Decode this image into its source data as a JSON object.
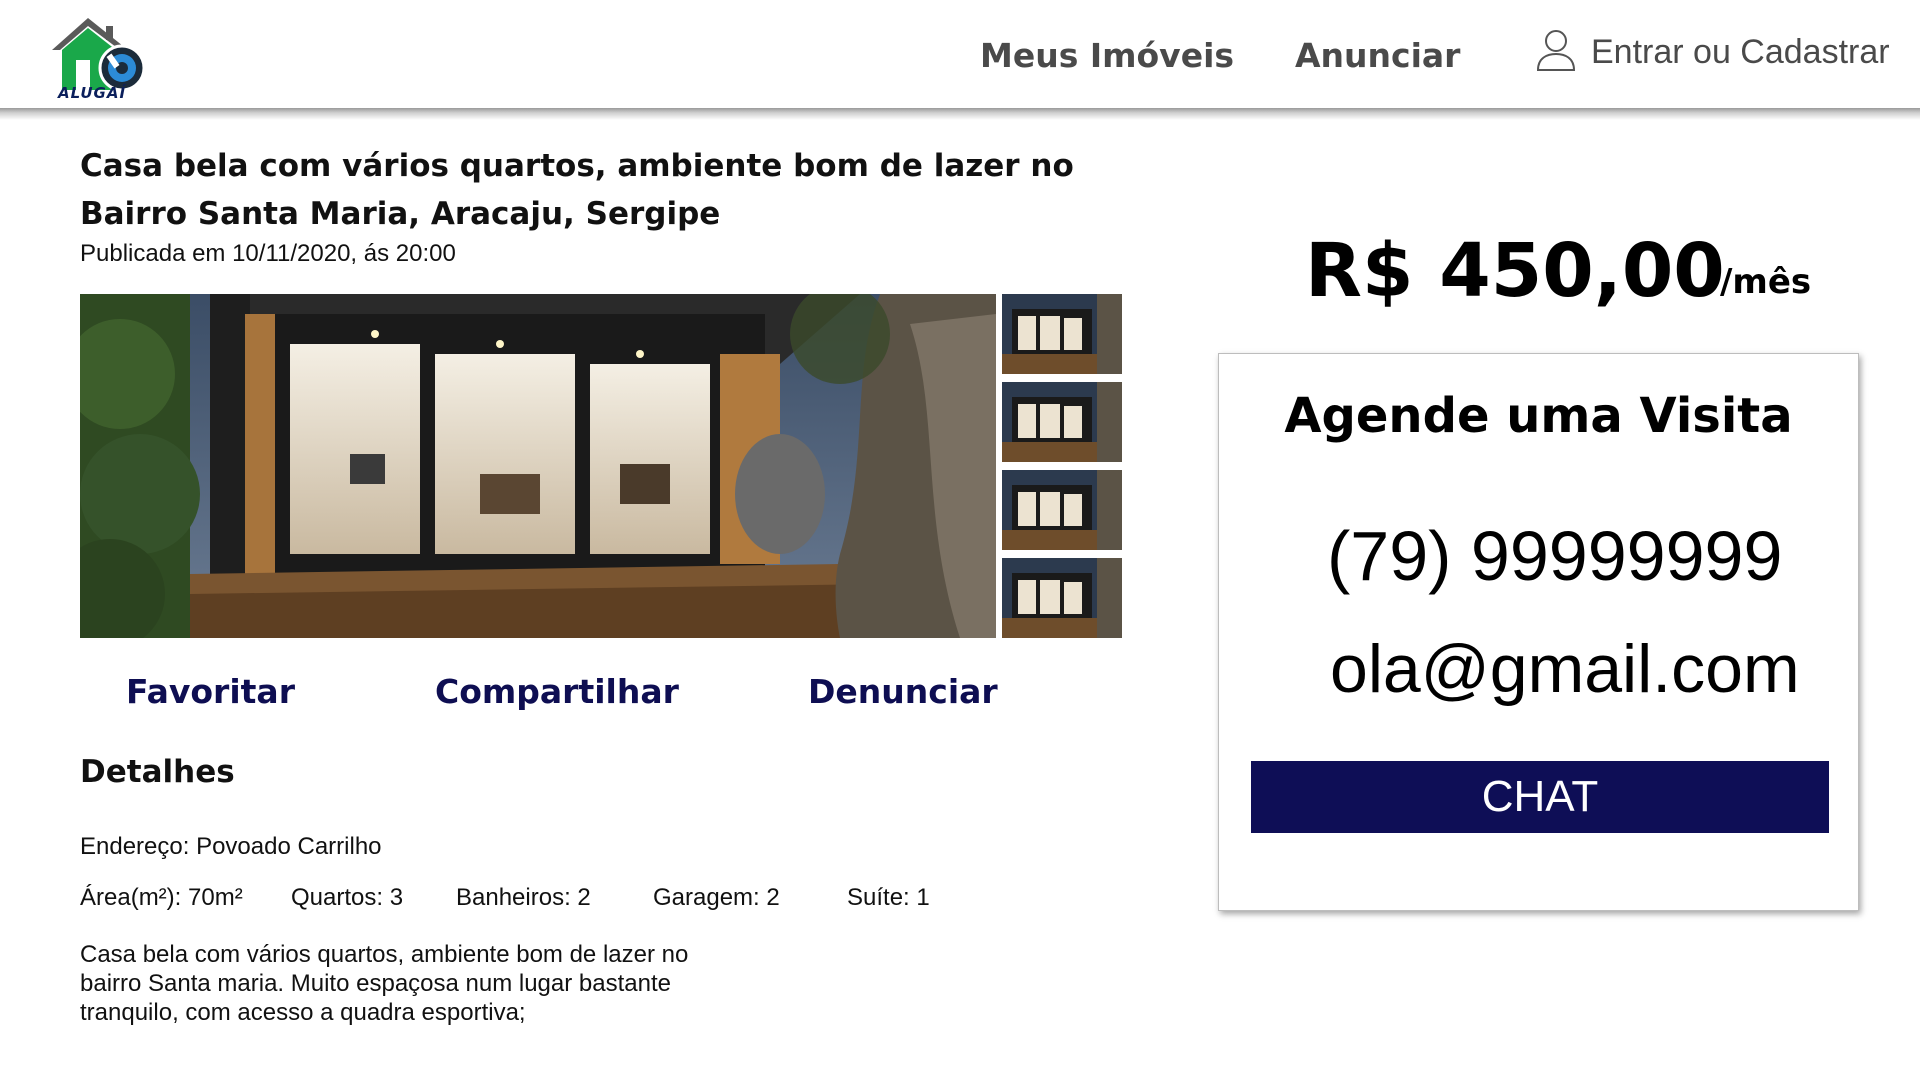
{
  "header": {
    "logo_text": "ALUGAÍ",
    "nav": {
      "meus_imoveis": "Meus Imóveis",
      "anunciar": "Anunciar"
    },
    "login_label": "Entrar ou Cadastrar",
    "login_icon": "user-icon"
  },
  "listing": {
    "title": "Casa bela com vários quartos, ambiente bom de lazer no Bairro Santa Maria, Aracaju, Sergipe",
    "published": "Publicada em 10/11/2020, ás 20:00"
  },
  "actions": {
    "favorite": "Favoritar",
    "share": "Compartilhar",
    "report": "Denunciar"
  },
  "details": {
    "heading": "Detalhes",
    "address": "Endereço: Povoado Carrilho",
    "area": "Área(m²): 70m²",
    "quartos": "Quartos: 3",
    "banheiros": "Banheiros: 2",
    "garagem": "Garagem: 2",
    "suite": "Suíte: 1",
    "description": "Casa bela com vários quartos, ambiente bom de lazer no bairro Santa maria. Muito espaçosa num lugar bastante tranquilo, com acesso a quadra esportiva;"
  },
  "price": {
    "amount": "R$ 450,00",
    "unit": "/mês"
  },
  "visit": {
    "title": "Agende uma Visita",
    "phone": "(79) 99999999",
    "email": "ola@gmail.com",
    "chat_label": "CHAT"
  },
  "colors": {
    "brand_navy": "#0e0e56",
    "logo_green": "#1aa84a",
    "nav_text": "#4a4a4a"
  }
}
